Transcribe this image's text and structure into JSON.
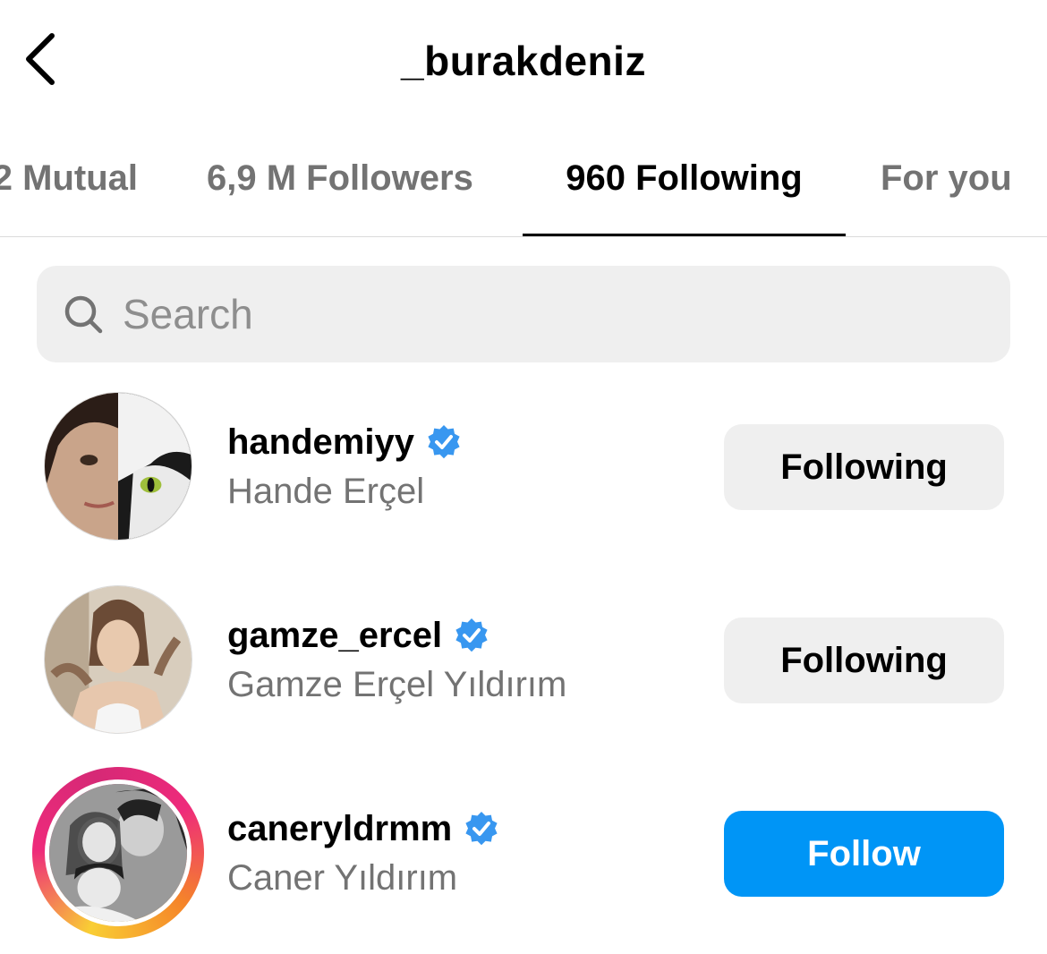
{
  "header": {
    "title": "_burakdeniz",
    "back_icon": "chevron-left-icon"
  },
  "tabs": [
    {
      "label": "2 Mutual",
      "active": false
    },
    {
      "label": "6,9 M Followers",
      "active": false
    },
    {
      "label": "960 Following",
      "active": true
    },
    {
      "label": "For you",
      "active": false
    }
  ],
  "search": {
    "placeholder": "Search",
    "value": "",
    "icon": "search-icon"
  },
  "users": [
    {
      "username": "handemiyy",
      "full_name": "Hande Erçel",
      "verified": true,
      "has_story": false,
      "button_label": "Following"
    },
    {
      "username": "gamze_ercel",
      "full_name": "Gamze Erçel Yıldırım",
      "verified": true,
      "has_story": false,
      "button_label": "Following"
    },
    {
      "username": "caneryldrmm",
      "full_name": "Caner Yıldırım",
      "verified": true,
      "has_story": true,
      "button_label": "Follow"
    }
  ],
  "colors": {
    "follow_button": "#0095f6",
    "following_button": "#efefef",
    "verified_badge": "#3897f0",
    "secondary_text": "#737373"
  }
}
